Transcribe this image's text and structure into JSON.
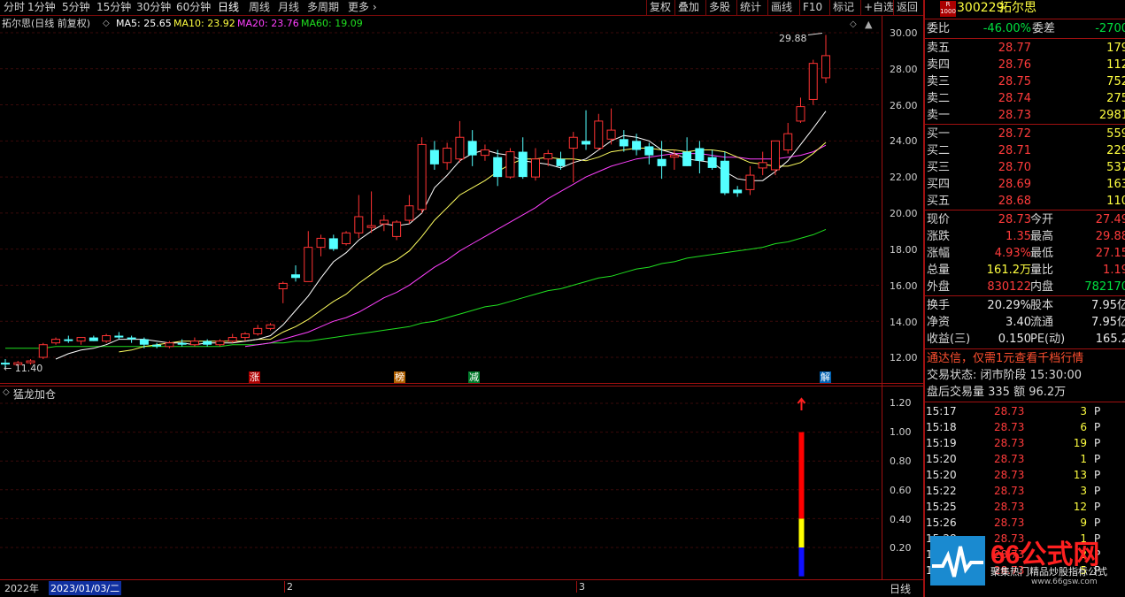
{
  "toolbar": {
    "period_tabs": [
      "分时",
      "1分钟",
      "5分钟",
      "15分钟",
      "30分钟",
      "60分钟",
      "日线",
      "周线",
      "月线",
      "多周期",
      "更多"
    ],
    "active_tab": "日线",
    "buttons": [
      "复权",
      "叠加",
      "多股",
      "统计",
      "画线",
      "F10",
      "标记",
      "+自选",
      "返回"
    ]
  },
  "chart_info": {
    "title": "拓尔思(日线 前复权)",
    "ma5": "MA5: 25.65",
    "ma10": "MA10: 23.92",
    "ma20": "MA20: 23.76",
    "ma60": "MA60: 19.09"
  },
  "colors": {
    "up": "#ff3333",
    "down": "#54ffff",
    "ma5": "#ffffff",
    "ma10": "#ffff60",
    "ma20": "#ff40ff",
    "ma60": "#20e020",
    "grid": "#3a0a0a",
    "frame": "#a01010"
  },
  "price_axis": {
    "labels": [
      "30.00",
      "28.00",
      "26.00",
      "24.00",
      "22.00",
      "20.00",
      "18.00",
      "16.00",
      "14.00",
      "12.00"
    ],
    "high_marker": "29.88",
    "low_marker": "← 11.40"
  },
  "event_markers": [
    "涨",
    "榜",
    "减",
    "解"
  ],
  "indicator": {
    "name": "猛龙加仓",
    "axis_labels": [
      "1.20",
      "1.00",
      "0.80",
      "0.60",
      "0.40",
      "0.20"
    ]
  },
  "date_axis": {
    "year": "2022年",
    "cursor_date": "2023/01/03/二",
    "months": [
      "2",
      "3"
    ],
    "period_label": "日线"
  },
  "chart_data": {
    "type": "candlestick",
    "ylim": [
      11,
      30.5
    ],
    "ohlc": [
      [
        11.7,
        11.9,
        11.4,
        11.6
      ],
      [
        11.6,
        11.8,
        11.5,
        11.7
      ],
      [
        11.7,
        11.9,
        11.6,
        11.8
      ],
      [
        12.0,
        12.8,
        11.9,
        12.7
      ],
      [
        12.8,
        13.1,
        12.7,
        13.0
      ],
      [
        13.0,
        13.2,
        12.8,
        12.9
      ],
      [
        12.9,
        13.1,
        12.7,
        13.1
      ],
      [
        13.1,
        13.2,
        12.9,
        12.9
      ],
      [
        12.9,
        13.3,
        12.8,
        13.2
      ],
      [
        13.2,
        13.4,
        13.0,
        13.1
      ],
      [
        13.1,
        13.2,
        12.8,
        13.0
      ],
      [
        13.0,
        13.1,
        12.5,
        12.7
      ],
      [
        12.7,
        12.8,
        12.5,
        12.6
      ],
      [
        12.6,
        12.9,
        12.5,
        12.8
      ],
      [
        12.8,
        13.0,
        12.6,
        12.7
      ],
      [
        12.7,
        13.1,
        12.6,
        12.9
      ],
      [
        12.9,
        13.0,
        12.6,
        12.7
      ],
      [
        12.7,
        13.0,
        12.6,
        12.9
      ],
      [
        12.9,
        13.3,
        12.8,
        13.1
      ],
      [
        13.1,
        13.4,
        12.9,
        13.3
      ],
      [
        13.3,
        13.8,
        13.2,
        13.6
      ],
      [
        13.6,
        13.9,
        13.5,
        13.8
      ],
      [
        15.8,
        16.2,
        15.0,
        16.1
      ],
      [
        16.6,
        17.1,
        16.2,
        16.4
      ],
      [
        16.2,
        19.0,
        16.2,
        18.1
      ],
      [
        18.1,
        18.8,
        17.6,
        18.6
      ],
      [
        18.6,
        18.8,
        17.9,
        18.0
      ],
      [
        18.3,
        19.0,
        18.2,
        18.9
      ],
      [
        18.9,
        21.0,
        18.6,
        19.8
      ],
      [
        19.2,
        21.2,
        18.9,
        19.3
      ],
      [
        19.4,
        19.9,
        19.0,
        19.6
      ],
      [
        18.7,
        19.6,
        18.5,
        19.5
      ],
      [
        19.6,
        21.0,
        19.4,
        20.4
      ],
      [
        20.2,
        24.2,
        20.0,
        23.8
      ],
      [
        23.5,
        24.0,
        22.4,
        22.7
      ],
      [
        22.8,
        23.9,
        22.4,
        23.6
      ],
      [
        23.0,
        25.1,
        22.8,
        24.2
      ],
      [
        24.0,
        24.6,
        22.6,
        23.2
      ],
      [
        23.2,
        23.8,
        22.9,
        23.5
      ],
      [
        23.1,
        23.5,
        21.5,
        22.0
      ],
      [
        22.0,
        23.6,
        21.9,
        23.4
      ],
      [
        23.4,
        24.2,
        21.9,
        22.0
      ],
      [
        22.0,
        23.6,
        21.8,
        23.0
      ],
      [
        23.0,
        23.5,
        22.6,
        23.3
      ],
      [
        23.0,
        23.4,
        22.4,
        22.6
      ],
      [
        23.6,
        24.5,
        21.7,
        24.2
      ],
      [
        24.0,
        25.7,
        23.5,
        23.8
      ],
      [
        23.6,
        25.5,
        23.5,
        25.1
      ],
      [
        24.1,
        25.8,
        23.8,
        24.6
      ],
      [
        24.1,
        24.6,
        23.4,
        23.7
      ],
      [
        24.0,
        24.4,
        23.2,
        23.5
      ],
      [
        23.7,
        23.9,
        22.7,
        23.2
      ],
      [
        23.0,
        24.0,
        21.9,
        22.6
      ],
      [
        23.1,
        23.5,
        22.4,
        23.2
      ],
      [
        23.4,
        24.2,
        22.6,
        22.6
      ],
      [
        23.6,
        24.0,
        22.2,
        22.9
      ],
      [
        23.1,
        23.5,
        22.4,
        22.5
      ],
      [
        22.9,
        23.4,
        21.0,
        21.1
      ],
      [
        21.3,
        21.5,
        20.9,
        21.1
      ],
      [
        21.3,
        22.6,
        21.0,
        22.1
      ],
      [
        22.5,
        23.4,
        22.1,
        22.8
      ],
      [
        22.4,
        24.0,
        22.1,
        24.0
      ],
      [
        23.5,
        25.0,
        23.3,
        24.4
      ],
      [
        25.1,
        26.4,
        25.0,
        25.9
      ],
      [
        26.3,
        28.5,
        26.0,
        28.3
      ],
      [
        27.5,
        29.88,
        27.2,
        28.73
      ]
    ],
    "series": [
      {
        "name": "MA5",
        "values": [
          null,
          null,
          null,
          null,
          11.9,
          12.2,
          12.4,
          12.5,
          12.7,
          13.0,
          13.0,
          13.0,
          12.9,
          12.8,
          12.8,
          12.7,
          12.8,
          12.8,
          12.8,
          12.9,
          13.0,
          13.2,
          13.8,
          14.6,
          15.4,
          16.4,
          17.3,
          17.8,
          18.5,
          19.0,
          19.4,
          19.3,
          19.4,
          20.0,
          21.4,
          22.1,
          22.9,
          23.3,
          23.5,
          23.3,
          23.2,
          22.9,
          22.8,
          22.7,
          22.5,
          22.8,
          23.0,
          23.5,
          24.0,
          24.3,
          24.2,
          24.0,
          23.5,
          23.3,
          23.0,
          22.9,
          22.8,
          22.3,
          21.9,
          21.8,
          21.8,
          22.3,
          22.9,
          23.8,
          24.7,
          25.65
        ]
      },
      {
        "name": "MA10",
        "values": [
          null,
          null,
          null,
          null,
          null,
          null,
          null,
          null,
          null,
          12.3,
          12.4,
          12.6,
          12.7,
          12.8,
          12.9,
          12.9,
          12.9,
          12.9,
          12.9,
          12.9,
          13.0,
          13.0,
          13.4,
          13.7,
          14.1,
          14.6,
          15.1,
          15.5,
          16.1,
          16.6,
          17.1,
          17.4,
          17.9,
          18.7,
          19.6,
          20.3,
          21.0,
          21.4,
          21.8,
          22.3,
          22.7,
          23.0,
          23.0,
          23.1,
          23.0,
          23.0,
          22.9,
          23.1,
          23.4,
          23.5,
          23.6,
          23.6,
          23.5,
          23.5,
          23.4,
          23.5,
          23.5,
          23.4,
          23.1,
          22.8,
          22.7,
          22.6,
          22.6,
          22.8,
          23.3,
          23.92
        ]
      },
      {
        "name": "MA20",
        "values": [
          null,
          null,
          null,
          null,
          null,
          null,
          null,
          null,
          null,
          null,
          null,
          null,
          null,
          null,
          null,
          null,
          null,
          null,
          null,
          12.6,
          12.7,
          12.8,
          13.0,
          13.2,
          13.4,
          13.7,
          14.0,
          14.2,
          14.5,
          14.9,
          15.3,
          15.6,
          16.0,
          16.5,
          17.0,
          17.4,
          17.9,
          18.3,
          18.7,
          19.1,
          19.5,
          19.9,
          20.3,
          20.8,
          21.2,
          21.6,
          22.0,
          22.3,
          22.6,
          22.8,
          23.0,
          23.1,
          23.2,
          23.3,
          23.3,
          23.3,
          23.2,
          23.1,
          23.1,
          23.0,
          23.0,
          23.0,
          23.1,
          23.2,
          23.4,
          23.76
        ]
      },
      {
        "name": "MA60",
        "values": [
          12.5,
          12.5,
          12.5,
          12.5,
          12.6,
          12.6,
          12.6,
          12.6,
          12.6,
          12.6,
          12.6,
          12.6,
          12.6,
          12.6,
          12.6,
          12.6,
          12.6,
          12.6,
          12.7,
          12.7,
          12.7,
          12.8,
          12.8,
          12.9,
          12.9,
          13.0,
          13.1,
          13.2,
          13.3,
          13.4,
          13.5,
          13.6,
          13.7,
          13.9,
          14.0,
          14.2,
          14.4,
          14.6,
          14.8,
          14.9,
          15.1,
          15.3,
          15.5,
          15.7,
          15.8,
          16.0,
          16.2,
          16.4,
          16.5,
          16.7,
          16.9,
          17.0,
          17.2,
          17.3,
          17.5,
          17.6,
          17.7,
          17.8,
          17.9,
          18.0,
          18.1,
          18.3,
          18.4,
          18.6,
          18.8,
          19.09
        ]
      }
    ],
    "signal_bar": {
      "index": 63,
      "segments": [
        {
          "from": 0,
          "to": 0.2,
          "color": "#1010ff"
        },
        {
          "from": 0.2,
          "to": 0.4,
          "color": "#ffff00"
        },
        {
          "from": 0.4,
          "to": 1.0,
          "color": "#ff0000"
        }
      ]
    }
  },
  "quote": {
    "code": "300229",
    "name": "拓尔思",
    "badge": "R\n1000",
    "weibi_label": "委比",
    "weibi_value": "-46.00%",
    "weicha_label": "委差",
    "weicha_value": "-2700",
    "asks": [
      {
        "label": "卖五",
        "price": "28.77",
        "vol": "179"
      },
      {
        "label": "卖四",
        "price": "28.76",
        "vol": "112"
      },
      {
        "label": "卖三",
        "price": "28.75",
        "vol": "752"
      },
      {
        "label": "卖二",
        "price": "28.74",
        "vol": "275"
      },
      {
        "label": "卖一",
        "price": "28.73",
        "vol": "2981"
      }
    ],
    "bids": [
      {
        "label": "买一",
        "price": "28.72",
        "vol": "559"
      },
      {
        "label": "买二",
        "price": "28.71",
        "vol": "229"
      },
      {
        "label": "买三",
        "price": "28.70",
        "vol": "537"
      },
      {
        "label": "买四",
        "price": "28.69",
        "vol": "163"
      },
      {
        "label": "买五",
        "price": "28.68",
        "vol": "110"
      }
    ],
    "stats": [
      {
        "l1": "现价",
        "v1": "28.73",
        "c1": "red",
        "l2": "今开",
        "v2": "27.49",
        "c2": "red"
      },
      {
        "l1": "涨跌",
        "v1": "1.35",
        "c1": "red",
        "l2": "最高",
        "v2": "29.88",
        "c2": "red"
      },
      {
        "l1": "涨幅",
        "v1": "4.93%",
        "c1": "red",
        "l2": "最低",
        "v2": "27.15",
        "c2": "red"
      },
      {
        "l1": "总量",
        "v1": "161.2万",
        "c1": "yel",
        "l2": "量比",
        "v2": "1.19",
        "c2": "red"
      },
      {
        "l1": "外盘",
        "v1": "830122",
        "c1": "red",
        "l2": "内盘",
        "v2": "782170",
        "c2": "grn"
      }
    ],
    "stats2": [
      {
        "l1": "换手",
        "v1": "20.29%",
        "l2": "股本",
        "v2": "7.95亿"
      },
      {
        "l1": "净资",
        "v1": "3.40",
        "l2": "流通",
        "v2": "7.95亿"
      },
      {
        "l1": "收益(三)",
        "v1": "0.150",
        "l2": "PE(动)",
        "v2": "165.2"
      }
    ],
    "ad_text": "通达信，仅需1元查看千档行情",
    "trade_status": "交易状态: 闭市阶段 15:30:00",
    "after_hours": "盘后交易量 335 额 96.2万",
    "ticks": [
      {
        "time": "15:17",
        "price": "28.73",
        "vol": "3",
        "flag": "P"
      },
      {
        "time": "15:18",
        "price": "28.73",
        "vol": "6",
        "flag": "P"
      },
      {
        "time": "15:19",
        "price": "28.73",
        "vol": "19",
        "flag": "P"
      },
      {
        "time": "15:20",
        "price": "28.73",
        "vol": "1",
        "flag": "P"
      },
      {
        "time": "15:20",
        "price": "28.73",
        "vol": "13",
        "flag": "P"
      },
      {
        "time": "15:22",
        "price": "28.73",
        "vol": "3",
        "flag": "P"
      },
      {
        "time": "15:25",
        "price": "28.73",
        "vol": "12",
        "flag": "P"
      },
      {
        "time": "15:26",
        "price": "28.73",
        "vol": "9",
        "flag": "P"
      },
      {
        "time": "15:28",
        "price": "28.73",
        "vol": "1",
        "flag": "P"
      },
      {
        "time": "15:29",
        "price": "28.73",
        "vol": "2",
        "flag": "P"
      },
      {
        "time": "15:30",
        "price": "28.73",
        "vol": "5",
        "flag": "P"
      }
    ]
  },
  "watermark": {
    "logo_text": "66公式网",
    "slogan": "聚集热门精品炒股指标公式",
    "url": "www.66gsw.com"
  }
}
